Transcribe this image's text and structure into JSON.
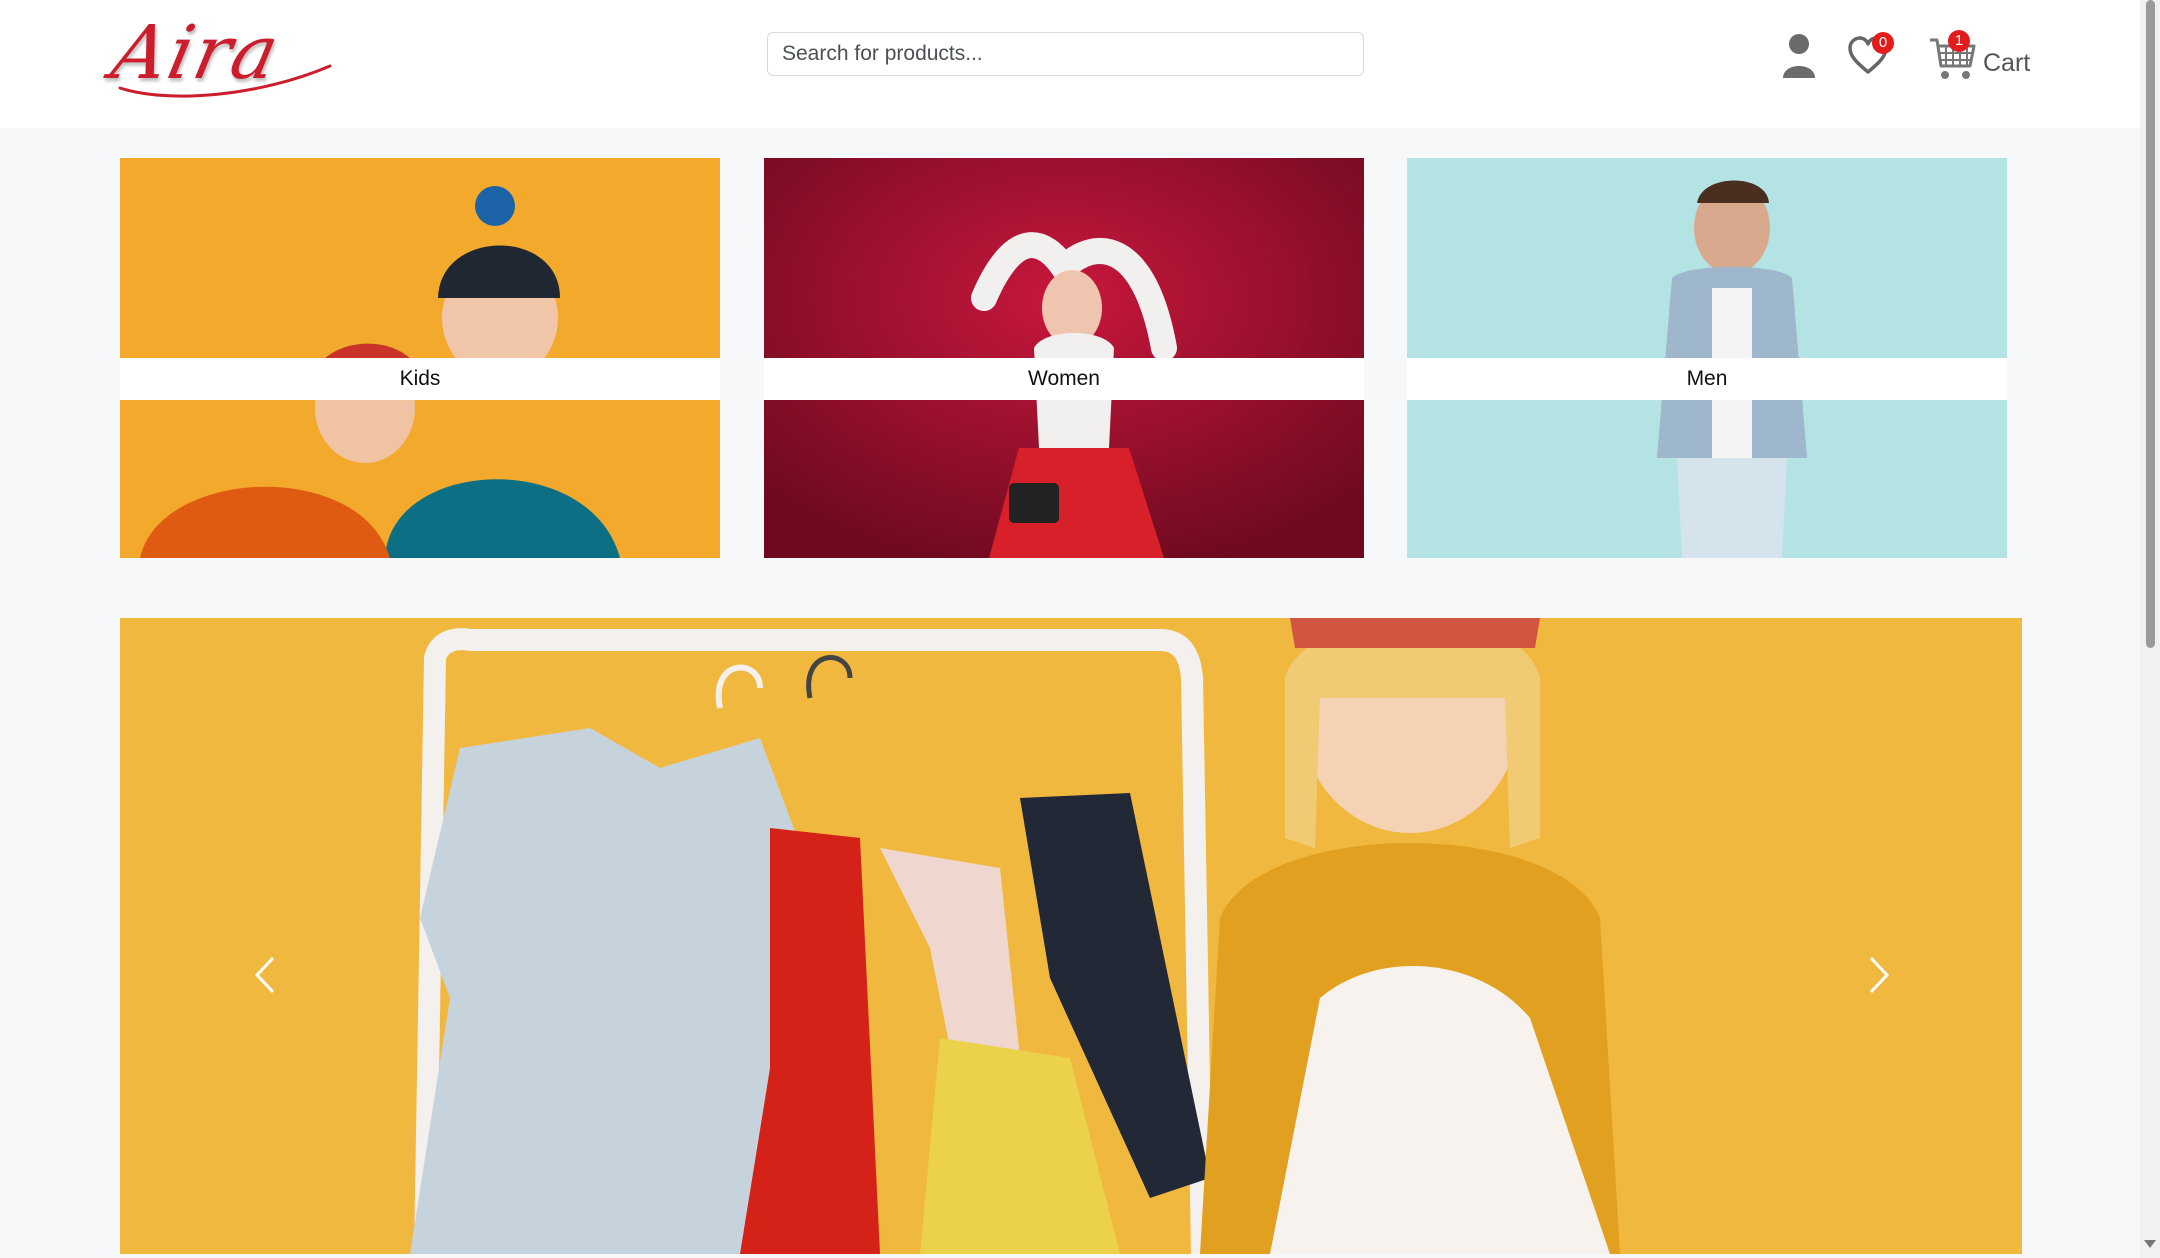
{
  "header": {
    "logo_text": "Aira",
    "search": {
      "placeholder": "Search for products..."
    },
    "wishlist": {
      "count": "0"
    },
    "cart": {
      "count": "1",
      "label": "Cart"
    }
  },
  "categories": [
    {
      "label": "Kids",
      "bg": "#f3a92b"
    },
    {
      "label": "Women",
      "bg": "#a3102d"
    },
    {
      "label": "Men",
      "bg": "#b4e3e3"
    }
  ],
  "colors": {
    "brand": "#cc1d2c",
    "badge": "#e41b1b",
    "hero_bg": "#f1b83f"
  },
  "icons": [
    "user-icon",
    "heart-icon",
    "shopping-cart-icon",
    "chevron-left-icon",
    "chevron-right-icon"
  ]
}
